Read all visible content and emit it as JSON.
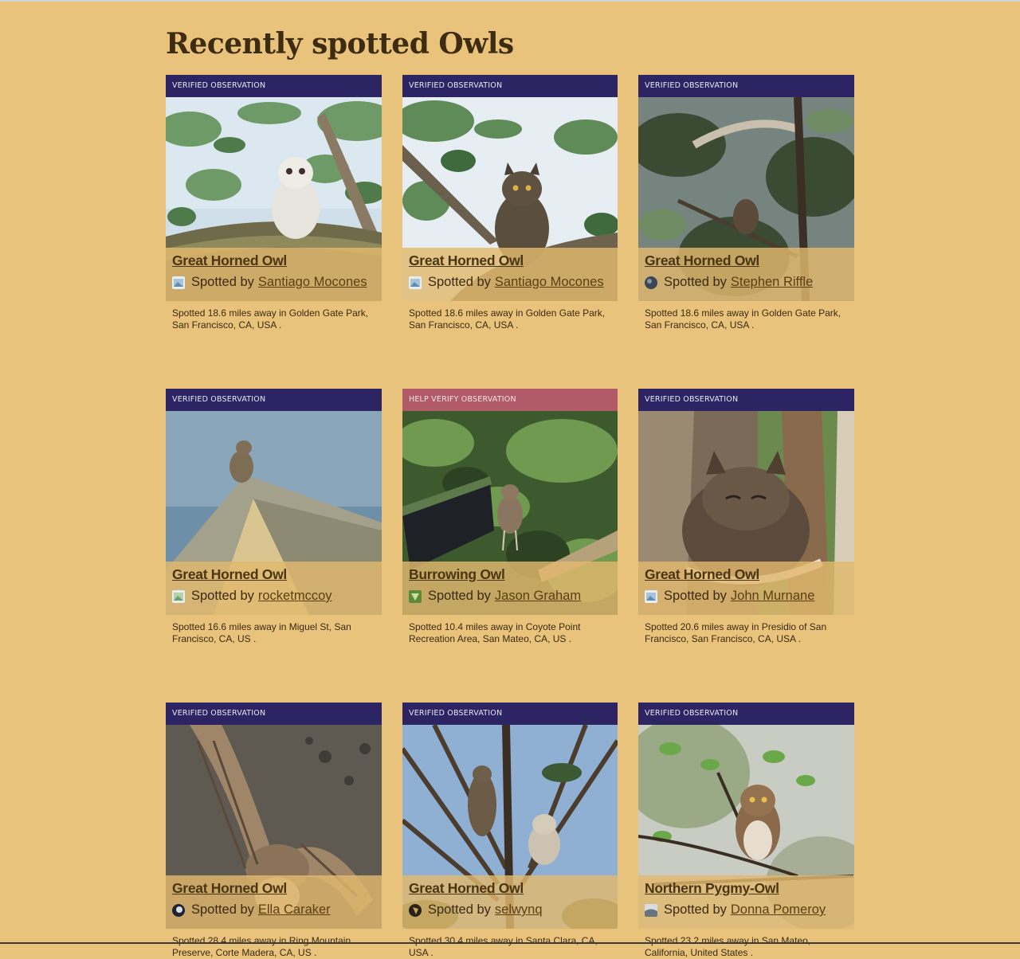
{
  "page": {
    "title": "Recently spotted Owls"
  },
  "colors": {
    "background": "#e9c27b",
    "verified_badge": "#2d2563",
    "help_badge": "#b05b67"
  },
  "cards": [
    {
      "badge": "VERIFIED OBSERVATION",
      "badge_type": "verified",
      "photo": "owlet-on-branch-photo",
      "species": "Great Horned Owl",
      "spotted_by_label": "Spotted by",
      "spotter": "Santiago Mocones",
      "meta": "Spotted  18.6 miles away  in Golden Gate Park, San Francisco, CA, USA ."
    },
    {
      "badge": "VERIFIED OBSERVATION",
      "badge_type": "verified",
      "photo": "owl-in-tree-photo",
      "species": "Great Horned Owl",
      "spotted_by_label": "Spotted by",
      "spotter": "Santiago Mocones",
      "meta": "Spotted  18.6 miles away  in Golden Gate Park, San Francisco, CA, USA ."
    },
    {
      "badge": "VERIFIED OBSERVATION",
      "badge_type": "verified",
      "photo": "owl-in-branches-photo",
      "species": "Great Horned Owl",
      "spotted_by_label": "Spotted by",
      "spotter": "Stephen Riffle",
      "meta": "Spotted  18.6 miles away  in Golden Gate Park, San Francisco, CA, USA ."
    },
    {
      "badge": "VERIFIED OBSERVATION",
      "badge_type": "verified",
      "photo": "owl-on-roof-photo",
      "species": "Great Horned Owl",
      "spotted_by_label": "Spotted by",
      "spotter": "rocketmccoy",
      "meta": "Spotted  16.6 miles away  in Miguel St, San Francisco, CA, US ."
    },
    {
      "badge": "HELP VERIFY OBSERVATION",
      "badge_type": "help",
      "photo": "burrowing-owl-photo",
      "species": "Burrowing Owl",
      "spotted_by_label": "Spotted by",
      "spotter": "Jason Graham",
      "meta": "Spotted  10.4 miles away  in Coyote Point Recreation Area, San Mateo, CA, US ."
    },
    {
      "badge": "VERIFIED OBSERVATION",
      "badge_type": "verified",
      "photo": "sleeping-owl-photo",
      "species": "Great Horned Owl",
      "spotted_by_label": "Spotted by",
      "spotter": "John Murnane",
      "meta": "Spotted  20.6 miles away  in Presidio of San Francisco, San Francisco, CA, USA ."
    },
    {
      "badge": "VERIFIED OBSERVATION",
      "badge_type": "verified",
      "photo": "owl-spread-wings-photo",
      "species": "Great Horned Owl",
      "spotted_by_label": "Spotted by",
      "spotter": "Ella Caraker",
      "meta": "Spotted  28.4 miles away  in Ring Mountain Preserve, Corte Madera, CA, US ."
    },
    {
      "badge": "VERIFIED OBSERVATION",
      "badge_type": "verified",
      "photo": "owl-family-in-pine-photo",
      "species": "Great Horned Owl",
      "spotted_by_label": "Spotted by",
      "spotter": "selwynq",
      "meta": "Spotted  30.4 miles away  in Santa Clara, CA, USA ."
    },
    {
      "badge": "VERIFIED OBSERVATION",
      "badge_type": "verified",
      "photo": "pygmy-owl-photo",
      "species": "Northern Pygmy-Owl",
      "spotted_by_label": "Spotted by",
      "spotter": "Donna Pomeroy",
      "meta": "Spotted  23.2 miles away  in San Mateo, California, United States ."
    }
  ]
}
